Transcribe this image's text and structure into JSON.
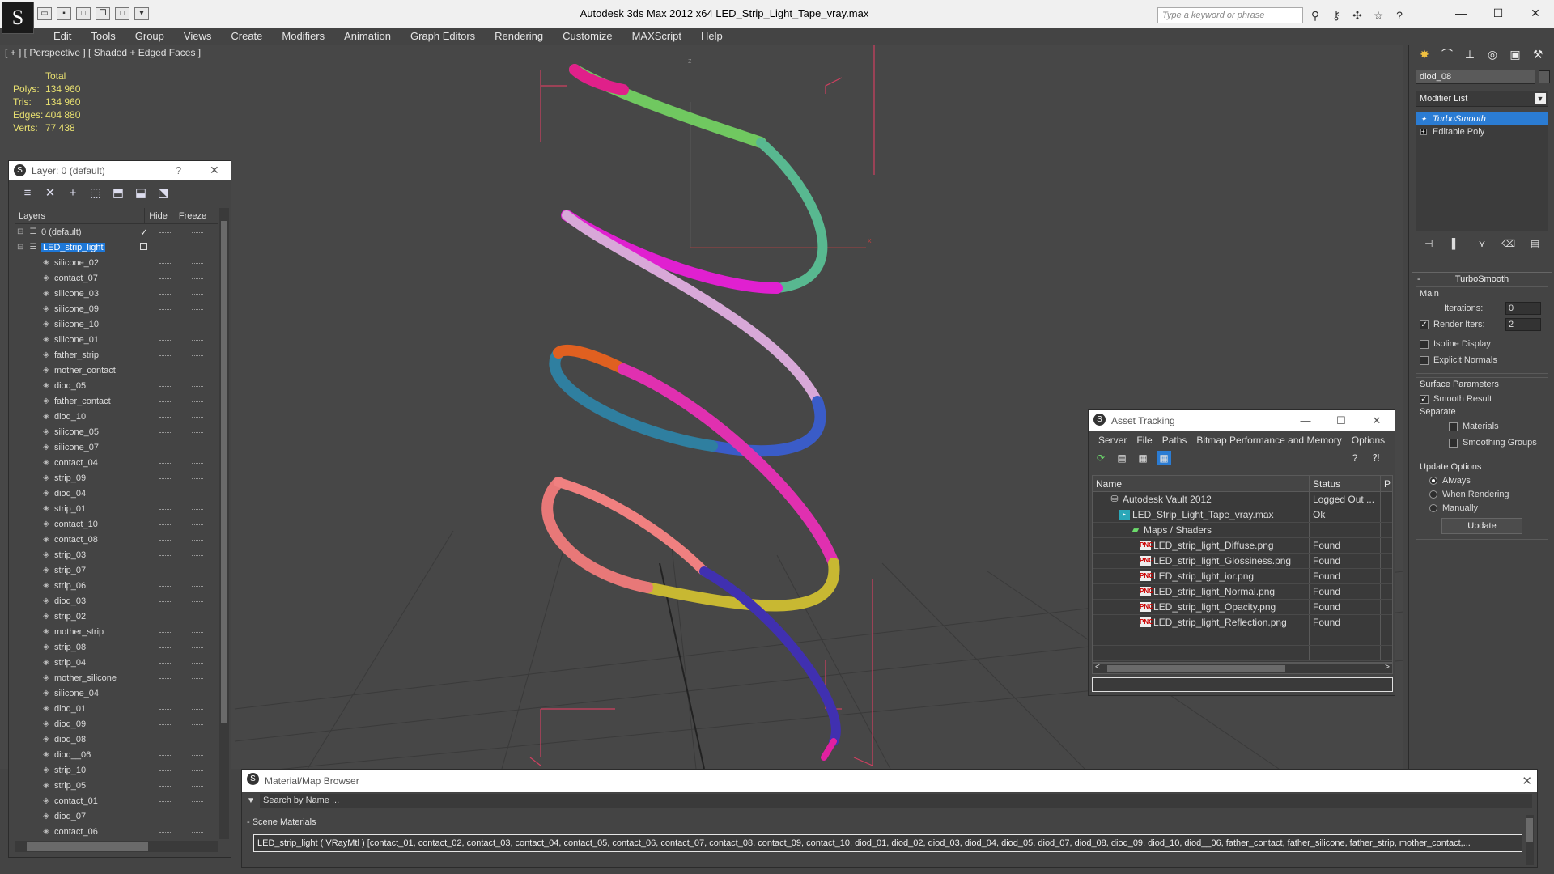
{
  "app": {
    "logo": "S",
    "window_title": "Autodesk 3ds Max  2012 x64      LED_Strip_Light_Tape_vray.max",
    "search_placeholder": "Type a keyword or phrase",
    "win_min": "—",
    "win_max": "☐",
    "win_close": "✕",
    "qa_icons": [
      "open-icon",
      "save-icon",
      "new-icon",
      "copy-icon",
      "undo-icon",
      "redo-icon"
    ]
  },
  "menu": [
    "Edit",
    "Tools",
    "Group",
    "Views",
    "Create",
    "Modifiers",
    "Animation",
    "Graph Editors",
    "Rendering",
    "Customize",
    "MAXScript",
    "Help"
  ],
  "viewport": {
    "label": "[ + ] [ Perspective ] [ Shaded + Edged Faces ]",
    "stats_header": "Total",
    "stats": [
      {
        "label": "Polys:",
        "value": "134 960"
      },
      {
        "label": "Tris:",
        "value": "134 960"
      },
      {
        "label": "Edges:",
        "value": "404 880"
      },
      {
        "label": "Verts:",
        "value": "77 438"
      }
    ],
    "axis_z": "z",
    "axis_x": "x"
  },
  "layer_panel": {
    "title": "Layer: 0 (default)",
    "help": "?",
    "close": "✕",
    "col_layers": "Layers",
    "col_hide": "Hide",
    "col_freeze": "Freeze",
    "layers": [
      {
        "name": "0 (default)",
        "indent": 1,
        "selected": false,
        "check": true
      },
      {
        "name": "LED_strip_light",
        "indent": 1,
        "selected": true,
        "check": false
      },
      {
        "name": "silicone_02",
        "indent": 2
      },
      {
        "name": "contact_07",
        "indent": 2
      },
      {
        "name": "silicone_03",
        "indent": 2
      },
      {
        "name": "silicone_09",
        "indent": 2
      },
      {
        "name": "silicone_10",
        "indent": 2
      },
      {
        "name": "silicone_01",
        "indent": 2
      },
      {
        "name": "father_strip",
        "indent": 2
      },
      {
        "name": "mother_contact",
        "indent": 2
      },
      {
        "name": "diod_05",
        "indent": 2
      },
      {
        "name": "father_contact",
        "indent": 2
      },
      {
        "name": "diod_10",
        "indent": 2
      },
      {
        "name": "silicone_05",
        "indent": 2
      },
      {
        "name": "silicone_07",
        "indent": 2
      },
      {
        "name": "contact_04",
        "indent": 2
      },
      {
        "name": "strip_09",
        "indent": 2
      },
      {
        "name": "diod_04",
        "indent": 2
      },
      {
        "name": "strip_01",
        "indent": 2
      },
      {
        "name": "contact_10",
        "indent": 2
      },
      {
        "name": "contact_08",
        "indent": 2
      },
      {
        "name": "strip_03",
        "indent": 2
      },
      {
        "name": "strip_07",
        "indent": 2
      },
      {
        "name": "strip_06",
        "indent": 2
      },
      {
        "name": "diod_03",
        "indent": 2
      },
      {
        "name": "strip_02",
        "indent": 2
      },
      {
        "name": "mother_strip",
        "indent": 2
      },
      {
        "name": "strip_08",
        "indent": 2
      },
      {
        "name": "strip_04",
        "indent": 2
      },
      {
        "name": "mother_silicone",
        "indent": 2
      },
      {
        "name": "silicone_04",
        "indent": 2
      },
      {
        "name": "diod_01",
        "indent": 2
      },
      {
        "name": "diod_09",
        "indent": 2
      },
      {
        "name": "diod_08",
        "indent": 2
      },
      {
        "name": "diod__06",
        "indent": 2
      },
      {
        "name": "strip_10",
        "indent": 2
      },
      {
        "name": "strip_05",
        "indent": 2
      },
      {
        "name": "contact_01",
        "indent": 2
      },
      {
        "name": "diod_07",
        "indent": 2
      },
      {
        "name": "contact_06",
        "indent": 2
      }
    ]
  },
  "command_panel": {
    "object_name": "diod_08",
    "modifier_list": "Modifier List",
    "stack": [
      {
        "name": "TurboSmooth",
        "active": true
      },
      {
        "name": "Editable Poly",
        "active": false
      }
    ],
    "rollout_title": "TurboSmooth",
    "main_label": "Main",
    "iterations_label": "Iterations:",
    "iterations_value": "0",
    "render_iters_label": "Render Iters:",
    "render_iters_value": "2",
    "isoline_label": "Isoline Display",
    "explicit_label": "Explicit Normals",
    "surface_label": "Surface Parameters",
    "smooth_label": "Smooth Result",
    "separate_label": "Separate",
    "materials_label": "Materials",
    "smoothing_groups_label": "Smoothing Groups",
    "update_options_label": "Update Options",
    "always_label": "Always",
    "when_rendering_label": "When Rendering",
    "manually_label": "Manually",
    "update_button": "Update",
    "minus": "-"
  },
  "asset_tracking": {
    "title": "Asset Tracking",
    "menu": [
      "Server",
      "File",
      "Paths",
      "Bitmap Performance and Memory",
      "Options"
    ],
    "col_name": "Name",
    "col_status": "Status",
    "col_p": "P",
    "rows": [
      {
        "name": "Autodesk Vault 2012",
        "status": "Logged Out ...",
        "indent": 20,
        "icon": "vault"
      },
      {
        "name": "LED_Strip_Light_Tape_vray.max",
        "status": "Ok",
        "indent": 32,
        "icon": "max"
      },
      {
        "name": "Maps / Shaders",
        "status": "",
        "indent": 46,
        "icon": "maps"
      },
      {
        "name": "LED_strip_light_Diffuse.png",
        "status": "Found",
        "indent": 58,
        "icon": "png"
      },
      {
        "name": "LED_strip_light_Glossiness.png",
        "status": "Found",
        "indent": 58,
        "icon": "png"
      },
      {
        "name": "LED_strip_light_ior.png",
        "status": "Found",
        "indent": 58,
        "icon": "png"
      },
      {
        "name": "LED_strip_light_Normal.png",
        "status": "Found",
        "indent": 58,
        "icon": "png"
      },
      {
        "name": "LED_strip_light_Opacity.png",
        "status": "Found",
        "indent": 58,
        "icon": "png"
      },
      {
        "name": "LED_strip_light_Reflection.png",
        "status": "Found",
        "indent": 58,
        "icon": "png"
      }
    ],
    "scroll_left": "<",
    "scroll_right": ">"
  },
  "material_browser": {
    "title": "Material/Map Browser",
    "close": "✕",
    "search_placeholder": "Search by Name ...",
    "group_label": "- Scene Materials",
    "entry": "LED_strip_light  ( VRayMtl )  [contact_01, contact_02, contact_03, contact_04, contact_05, contact_06, contact_07, contact_08, contact_09, contact_10, diod_01, diod_02, diod_03, diod_04, diod_05, diod_07, diod_08, diod_09, diod_10, diod__06, father_contact, father_silicone, father_strip, mother_contact,..."
  },
  "colors": {
    "selection_blue": "#1e78d8",
    "stat_yellow": "#e8e070",
    "helix_magenta": "#e020d0",
    "helix_green": "#70c860",
    "helix_blue": "#3a5cc8",
    "helix_yellow": "#c8b832"
  }
}
